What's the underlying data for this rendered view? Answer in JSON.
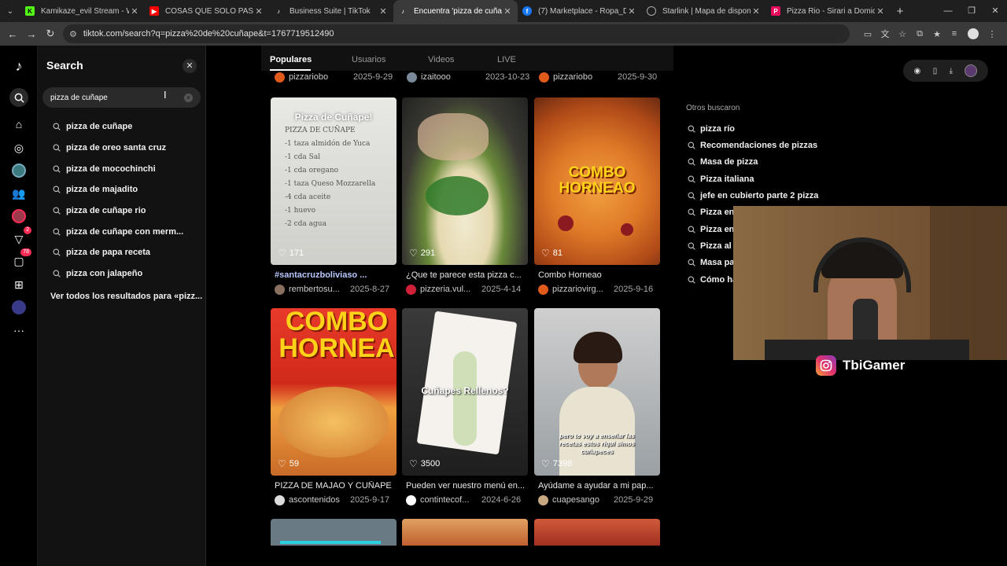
{
  "browser": {
    "tabs": [
      {
        "title": "Kamikaze_evil Stream - Watch L",
        "icon": "kick-icon",
        "color": "#53fc18"
      },
      {
        "title": "COSAS QUE SOLO PASAN EN B",
        "icon": "youtube-icon",
        "color": "#ff0000"
      },
      {
        "title": "Business Suite | TikTok",
        "icon": "tiktok-icon",
        "color": "#ffffff"
      },
      {
        "title": "Encuentra 'pizza de cuñape' en",
        "icon": "tiktok-icon",
        "color": "#ffffff"
      },
      {
        "title": "(7) Marketplace - Ropa_Dc.com",
        "icon": "facebook-icon",
        "color": "#1877f2"
      },
      {
        "title": "Starlink | Mapa de disponibilid",
        "icon": "starlink-icon",
        "color": "#cccccc"
      },
      {
        "title": "Pizza Rio - Sirari a Domicilio |P",
        "icon": "pedidosya-icon",
        "color": "#ea0a5c"
      }
    ],
    "url": "tiktok.com/search?q=pizza%20de%20cuñape&t=1767719512490"
  },
  "search": {
    "title": "Search",
    "query": "pizza de cuñape",
    "suggestions": [
      "pizza de cuñape",
      "pizza de oreo santa cruz",
      "pizza de mocochinchi",
      "pizza de majadito",
      "pizza de cuñape rio",
      "pizza de cuñape con merm...",
      "pizza de papa receta",
      "pizza con jalapeño"
    ],
    "see_all": "Ver todos los resultados para «pizz..."
  },
  "rail": {
    "messages_badge": "78",
    "inbox_badge": "2"
  },
  "content_tabs": [
    "Populares",
    "Usuarios",
    "Videos",
    "LIVE"
  ],
  "top_row": [
    {
      "user": "pizzariobo",
      "date": "2025-9-29"
    },
    {
      "user": "izaitooo",
      "date": "2023-10-23"
    },
    {
      "user": "pizzariobo",
      "date": "2025-9-30"
    }
  ],
  "videos": [
    {
      "likes": "171",
      "caption": "#santacruzboliviaso ...",
      "user": "rembertosu...",
      "date": "2025-8-27",
      "overlay": "Pizza de Cuñape!"
    },
    {
      "likes": "291",
      "caption": "¿Que te parece esta pizza c...",
      "user": "pizzeria.vul...",
      "date": "2025-4-14",
      "overlay": ""
    },
    {
      "likes": "81",
      "caption": "Combo Horneao",
      "user": "pizzariovirg...",
      "date": "2025-9-16",
      "overlay": "COMBO HORNEAO"
    },
    {
      "likes": "59",
      "caption": "PIZZA DE MAJAO Y CUÑAPE",
      "user": "ascontenidos",
      "date": "2025-9-17",
      "overlay": "COMBO HORNEA"
    },
    {
      "likes": "3500",
      "caption": "Pueden ver nuestro menú en...",
      "user": "contintecof...",
      "date": "2024-6-26",
      "overlay": "Cuñapes Rellenos?"
    },
    {
      "likes": "7398",
      "caption": "Ayúdame a ayudar a mi pap...",
      "user": "cuapesango",
      "date": "2025-9-29",
      "overlay": "pero te voy a enseñar las recetas estos riqui simos cuñapeces"
    }
  ],
  "whiteboard_lines": [
    "PIZZA DE CUÑAPE",
    "-1 taza almidón de Yuca",
    "-1 cda Sal",
    "-1 cda oregano",
    "-1 taza Queso Mozzarella",
    "-4 cda aceite",
    "-1 huevo",
    "-2 cda agua"
  ],
  "related": {
    "title": "Otros buscaron",
    "items": [
      "pizza río",
      "Recomendaciones de pizzas",
      "Masa de pizza",
      "Pizza italiana",
      "jefe en cubierto parte 2 pizza",
      "Pizza en",
      "Pizza en",
      "Pizza al p",
      "Masa pa",
      "Cómo ha"
    ]
  },
  "streamer": {
    "name": "TbiGamer"
  },
  "colors": {
    "accent": "#fe2c55",
    "panel": "#121212"
  }
}
